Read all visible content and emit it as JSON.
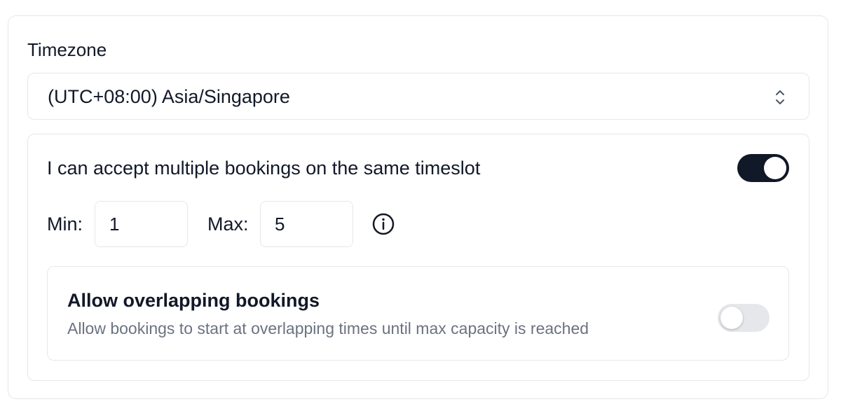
{
  "timezone": {
    "label": "Timezone",
    "selected": "(UTC+08:00) Asia/Singapore"
  },
  "multiple_bookings": {
    "label": "I can accept multiple bookings on the same timeslot",
    "enabled": true,
    "min_label": "Min:",
    "min_value": "1",
    "max_label": "Max:",
    "max_value": "5"
  },
  "overlapping": {
    "title": "Allow overlapping bookings",
    "description": "Allow bookings to start at overlapping times until max capacity is reached",
    "enabled": false
  },
  "colors": {
    "toggle_on": "#111827",
    "toggle_off": "#e5e7eb",
    "text_primary": "#111827",
    "text_secondary": "#6b7280",
    "border": "#e5e7eb"
  },
  "icons": {
    "select_chevrons": "chevron-up-down-icon",
    "info": "info-circle-icon"
  }
}
